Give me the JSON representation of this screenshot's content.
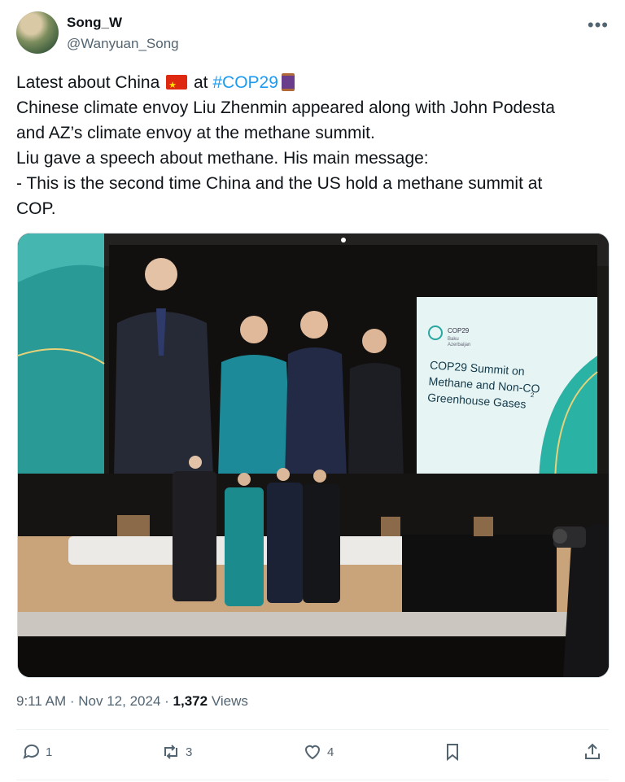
{
  "author": {
    "name": "Song_W",
    "handle": "@Wanyuan_Song",
    "more_icon": "more-dots-icon"
  },
  "tweet": {
    "line1_prefix": "Latest about China",
    "line1_mid": "at",
    "hashtag": "#COP29",
    "line2": "Chinese climate envoy Liu Zhenmin appeared along with John Podesta",
    "line3": "and AZ’s climate envoy at the methane summit.",
    "line4": "Liu gave a speech about methane. His main message:",
    "line5": "- This is the second time China and the US hold a methane summit at",
    "line6": "COP."
  },
  "photo": {
    "screen_logo": "COP29",
    "screen_logo_sub1": "Baku",
    "screen_logo_sub2": "Azerbaijan",
    "screen_title1": "COP29 Summit on",
    "screen_title2": "Methane and Non-CO",
    "screen_title_sub": "2",
    "screen_title3": "Greenhouse Gases"
  },
  "meta": {
    "time": "9:11 AM",
    "sep1": "·",
    "date": "Nov 12, 2024",
    "sep2": "·",
    "views_count": "1,372",
    "views_label": "Views"
  },
  "actions": {
    "reply_count": "1",
    "retweet_count": "3",
    "like_count": "4"
  },
  "colors": {
    "accent": "#1d9bf0",
    "muted": "#536471",
    "text": "#0f1419"
  }
}
